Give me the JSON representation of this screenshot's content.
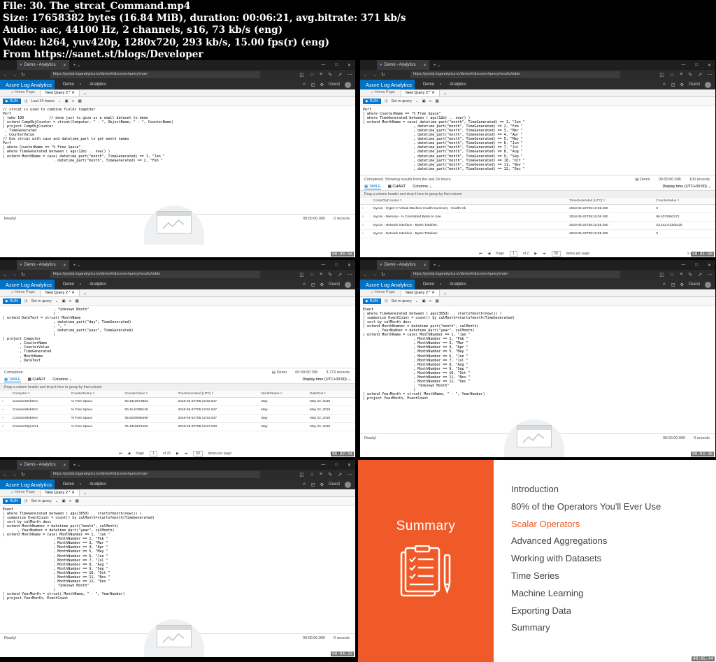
{
  "header": {
    "lines": [
      "File: 30. The_strcat_Command.mp4",
      "Size: 17658382 bytes (16.84 MiB), duration: 00:06:21, avg.bitrate: 371 kb/s",
      "Audio: aac, 44100 Hz, 2 channels, s16, 73 kb/s (eng)",
      "Video: h264, yuv420p, 1280x720, 293 kb/s, 15.00 fps(r) (eng)",
      "From https://sanet.st/blogs/Developer"
    ]
  },
  "app": {
    "tab_title": "Demo - Analytics",
    "brand": "Azure Log Analytics",
    "link_demo": "Demo",
    "link_analytics": "Analytics",
    "guest": "Guest",
    "tab_home": "Home Page",
    "tab_query": "New Query 2 *",
    "run": "RUN",
    "time_last24": "Last 24 hours",
    "time_set": "Set in query",
    "ready": "Ready!",
    "zero_time": "00:00:00.000",
    "zero_records": "0 records",
    "completed": "Completed",
    "results_msg": "Completed. Showing results from the last 24 hours.",
    "table_tab": "TABLE",
    "chart_tab": "CHART",
    "columns": "Columns",
    "group_hint": "Drag a column header and drop it here to group by that column",
    "display_time": "Display time (UTC+00:00)",
    "page": "Page",
    "items_per_page": "items per page",
    "demo": "Demo"
  },
  "thumbs": [
    {
      "url": "https://portal.loganalytics.io/demo#/discover/query/main",
      "time_label": "Last 24 hours",
      "timestamp": "00:00:56",
      "code": [
        "// strcat is used to combine fields together",
        "Perf",
        "| take 100            // done just to give us a small dataset to demo",
        "| extend CompObjCounter = strcat(Computer, \" - \", ObjectName, \" - \", CounterName)",
        "| project CompObjCounter",
        " , TimeGenerated",
        " , CounterValue",
        "",
        "",
        "// Use strcat with case and datetime_part to get month names",
        "Perf",
        "| where CounterName == \"% Free Space\"",
        "| where TimeGenerated between ( ago(12m) .. now() )",
        "| extend MonthName = case( datetime_part(\"month\", TimeGenerated) == 1, \"Jan \"",
        "                        , datetime_part(\"month\", TimeGenerated) == 2, \"Feb \""
      ]
    },
    {
      "url": "https://portal.loganalytics.io/demo#/discover/query/results/table",
      "time_label": "Set in query",
      "timestamp": "00:01:50",
      "exec_time": "00:00:00.696",
      "records": "100 records",
      "code": [
        "Perf",
        "| where CounterName == \"% Free Space\"",
        "| where TimeGenerated between ( ago(12m) .. now() )",
        "| extend MonthName = case( datetime_part(\"month\", TimeGenerated) == 1, \"Jan \"",
        "                        , datetime_part(\"month\", TimeGenerated) == 2, \"Feb \"",
        "                        , datetime_part(\"month\", TimeGenerated) == 3, \"Mar \"",
        "                        , datetime_part(\"month\", TimeGenerated) == 4, \"Apr \"",
        "                        , datetime_part(\"month\", TimeGenerated) == 5, \"May \"",
        "                        , datetime_part(\"month\", TimeGenerated) == 6, \"Jun \"",
        "                        , datetime_part(\"month\", TimeGenerated) == 7, \"Jul \"",
        "                        , datetime_part(\"month\", TimeGenerated) == 8, \"Aug \"",
        "                        , datetime_part(\"month\", TimeGenerated) == 9, \"Sep \"",
        "                        , datetime_part(\"month\", TimeGenerated) == 10, \"Oct \"",
        "                        , datetime_part(\"month\", TimeGenerated) == 11, \"Nov \"",
        "                        , datetime_part(\"month\", TimeGenerated) == 12, \"Dec \""
      ],
      "columns": [
        "CompObjCounter",
        "TimeGenerated [UTC]",
        "CounterValue"
      ],
      "rows": [
        [
          "mycon - Hyper-V Virtual Machine Health Summary - Health Ok",
          "2018-05-22T05:15:05.280",
          "0"
        ],
        [
          "mycon - Memory - % Committed Bytes In Use",
          "2018-05-22T05:15:05.280",
          "86.4072952271"
        ],
        [
          "mycon - Network Interface - Bytes Total/sec",
          "2018-05-22T05:15:05.280",
          "23,443.61328125"
        ],
        [
          "mycon - Network Interface - Bytes Total/sec",
          "2018-05-22T05:15:05.280",
          "0"
        ]
      ],
      "page_no": "1",
      "of": "of 2",
      "per_page": "50",
      "range": "1 - 50 of"
    },
    {
      "url": "https://portal.loganalytics.io/demo#/discover/query/results/table",
      "time_label": "Set in query",
      "timestamp": "00:02:44",
      "exec_time": "00:00:00.786",
      "records": "3,779 records",
      "code": [
        "                        , \"Unknown Month\"",
        "                        )",
        "| extend DateText = strcat( MonthName",
        "                        , datetime_part(\"day\", TimeGenerated)",
        "                        , \", \"",
        "                        , datetime_part(\"year\", TimeGenerated)",
        "                        )",
        "| project Computer",
        "        , CounterName",
        "        , CounterValue",
        "        , TimeGenerated",
        "        , MonthName",
        "        , DateText"
      ],
      "columns": [
        "Computer",
        "CounterName",
        "CounterValue",
        "TimeGenerated [UTC]",
        "MonthName",
        "DateText"
      ],
      "rows": [
        [
          "ContosoWebSrvr",
          "% Free Space",
          "90.4310073853",
          "2018-05-22T05:12:52.547",
          "May",
          "May 22, 2018"
        ],
        [
          "ContosoWebSrvr",
          "% Free Space",
          "90.4144396118",
          "2018-05-22T05:12:52.547",
          "May",
          "May 22, 2018"
        ],
        [
          "ContosoWebSrvr",
          "% Free Space",
          "93.6229095459",
          "2018-05-22T05:12:52.547",
          "May",
          "May 22, 2018"
        ],
        [
          "ContosoSQLSrv1",
          "% Free Space",
          "75.4315872192",
          "2018-05-22T05:12:57.033",
          "May",
          "May 22, 2018"
        ]
      ],
      "page_no": "1",
      "of": "of 76",
      "per_page": "50",
      "range": "1 - 50"
    },
    {
      "url": "https://portal.loganalytics.io/demo#/discover/query/main",
      "time_label": "Set in query",
      "timestamp": "00:03:38",
      "code": [
        "Event",
        "| where TimeGenerated between ( ago(365d) .. startofmonth(now()) )",
        "| summarize EventCount = count() by calMonth=startofmonth(TimeGenerated)",
        "| sort by calMonth desc",
        "| extend MonthNumber = datetime_part(\"month\", calMonth)",
        "       , YearNumber = datetime_part(\"year\", calMonth)",
        "| extend MonthName = case( MonthNumber == 1, \"Jan \"",
        "                        , MonthNumber == 2, \"Feb \"",
        "                        , MonthNumber == 3, \"Mar \"",
        "                        , MonthNumber == 4, \"Apr \"",
        "                        , MonthNumber == 5, \"May \"",
        "                        , MonthNumber == 6, \"Jun \"",
        "                        , MonthNumber == 7, \"Jul \"",
        "                        , MonthNumber == 8, \"Aug \"",
        "                        , MonthNumber == 9, \"Sep \"",
        "                        , MonthNumber == 10, \"Oct \"",
        "                        , MonthNumber == 11, \"Nov \"",
        "                        , MonthNumber == 12, \"Dec \"",
        "                        , \"Unknown Month\"",
        "                        )",
        "| extend YearMonth = strcat( MonthName, \" - \", YearNumber)",
        "| project YearMonth, EventCount"
      ]
    },
    {
      "url": "https://portal.loganalytics.io/demo#/discover/query/main",
      "time_label": "Set in query",
      "timestamp": "00:04:33",
      "code": [
        "Event",
        "| where TimeGenerated between ( ago(365d) .. startofmonth(now()) )",
        "| summarize EventCount = count() by calMonth=startofmonth(TimeGenerated)",
        "| sort by calMonth desc",
        "| extend MonthNumber = datetime_part(\"month\", calMonth)",
        "       , YearNumber = datetime_part(\"year\", calMonth)",
        "| extend MonthName = case( MonthNumber == 1, \"Jan \"",
        "                        , MonthNumber == 2, \"Feb \"",
        "                        , MonthNumber == 3, \"Mar \"",
        "                        , MonthNumber == 4, \"Apr \"",
        "                        , MonthNumber == 5, \"May \"",
        "                        , MonthNumber == 6, \"Jun \"",
        "                        , MonthNumber == 7, \"Jul \"",
        "                        , MonthNumber == 8, \"Aug \"",
        "                        , MonthNumber == 9, \"Sep \"",
        "                        , MonthNumber == 10, \"Oct \"",
        "                        , MonthNumber == 11, \"Nov \"",
        "                        , MonthNumber == 12, \"Dec \"",
        "                        , \"Unknown Month\"",
        "                        )",
        "| extend YearMonth = strcat( MonthName, \" - \", YearNumber)",
        "| project YearMonth, EventCount"
      ]
    }
  ],
  "summary": {
    "title": "Summary",
    "timestamp": "00:05:44",
    "items": [
      "Introduction",
      "80% of the Operators You'll Ever Use",
      "Scalar Operators",
      "Advanced Aggregations",
      "Working with Datasets",
      "Time Series",
      "Machine Learning",
      "Exporting Data",
      "Summary"
    ],
    "highlight_index": 2,
    "accent": "#f05a28"
  }
}
